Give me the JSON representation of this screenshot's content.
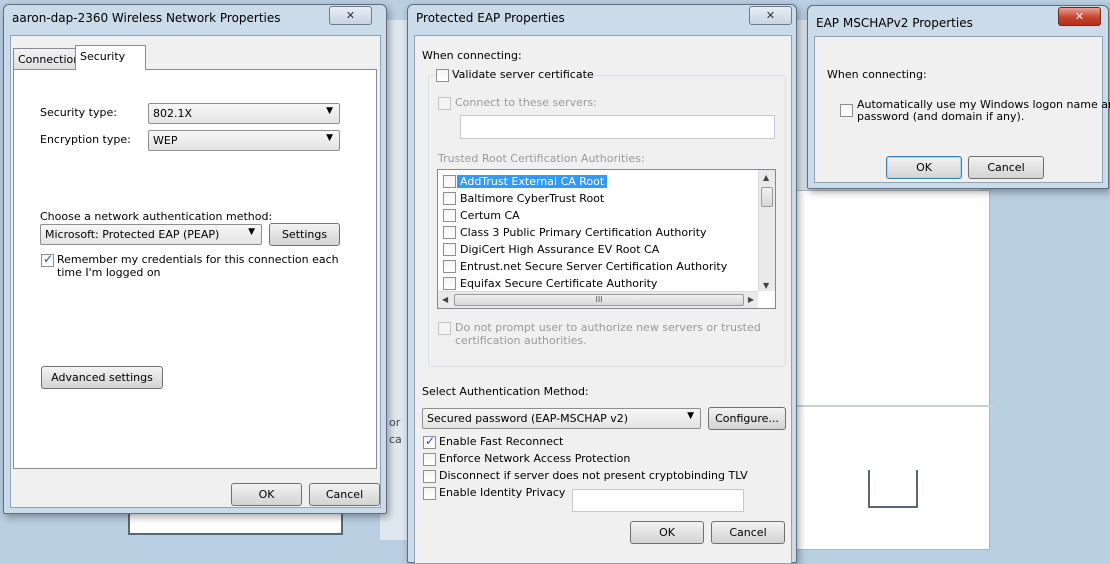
{
  "window1": {
    "title": "aaron-dap-2360 Wireless Network Properties",
    "close": "✕",
    "tabs": [
      "Connection",
      "Security"
    ],
    "security_type_label": "Security type:",
    "security_type_value": "802.1X",
    "encryption_type_label": "Encryption type:",
    "encryption_type_value": "WEP",
    "auth_method_label": "Choose a network authentication method:",
    "auth_method_value": "Microsoft: Protected EAP (PEAP)",
    "settings_button": "Settings",
    "remember_label_1": "Remember my credentials for this connection each",
    "remember_label_2": "time I'm logged on",
    "remember_checked": true,
    "advanced_button": "Advanced settings",
    "ok_button": "OK",
    "cancel_button": "Cancel"
  },
  "window2": {
    "title": "Protected EAP Properties",
    "close": "✕",
    "when_connecting": "When connecting:",
    "validate_cert": "Validate server certificate",
    "connect_servers": "Connect to these servers:",
    "trusted_root": "Trusted Root Certification Authorities:",
    "ca_list": [
      "AddTrust External CA Root",
      "Baltimore CyberTrust Root",
      "Certum CA",
      "Class 3 Public Primary Certification Authority",
      "DigiCert High Assurance EV Root CA",
      "Entrust.net Secure Server Certification Authority",
      "Equifax Secure Certificate Authority"
    ],
    "scroll_grip": "III",
    "no_prompt_1": "Do not prompt user to authorize new servers or trusted",
    "no_prompt_2": "certification authorities.",
    "select_auth_label": "Select Authentication Method:",
    "auth_value": "Secured password (EAP-MSCHAP v2)",
    "configure_button": "Configure...",
    "opt_fast_reconnect": "Enable Fast Reconnect",
    "opt_nap": "Enforce Network Access Protection",
    "opt_disconnect": "Disconnect if server does not present cryptobinding TLV",
    "opt_identity": "Enable Identity Privacy",
    "ok_button": "OK",
    "cancel_button": "Cancel"
  },
  "window3": {
    "title": "EAP MSCHAPv2 Properties",
    "close": "✕",
    "when_connecting": "When connecting:",
    "auto_logon_1": "Automatically use my Windows logon name and",
    "auto_logon_2": "password (and domain if any).",
    "ok_button": "OK",
    "cancel_button": "Cancel"
  },
  "background": {
    "frag_or": "or",
    "frag_ca": "ca"
  }
}
